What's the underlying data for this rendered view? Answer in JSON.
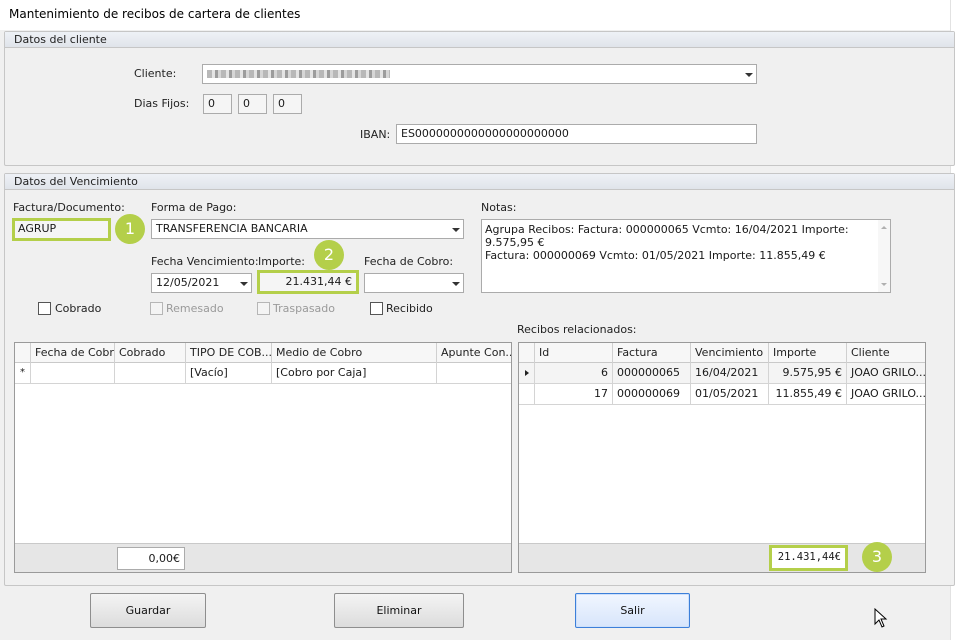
{
  "window": {
    "title": "Mantenimiento de recibos de cartera de clientes"
  },
  "cliente_section": {
    "title": "Datos del cliente",
    "cliente_label": "Cliente:",
    "dias_fijos_label": "Dias Fijos:",
    "dias_fijos": [
      "0",
      "0",
      "0"
    ],
    "iban_label": "IBAN:",
    "iban": "ES0000000000000000000000"
  },
  "vencimiento_section": {
    "title": "Datos del Vencimiento",
    "factura_label": "Factura/Documento:",
    "factura_value": "AGRUP",
    "forma_pago_label": "Forma de Pago:",
    "forma_pago_value": "TRANSFERENCIA BANCARIA",
    "fecha_venc_label": "Fecha Vencimiento:",
    "fecha_venc_value": "12/05/2021",
    "importe_label": "Importe:",
    "importe_value": "21.431,44 €",
    "fecha_cobro_label": "Fecha de Cobro:",
    "fecha_cobro_value": "",
    "notas_label": "Notas:",
    "notas_lines": [
      "Agrupa Recibos: Factura: 000000065 Vcmto: 16/04/2021 Importe: 9.575,95 €",
      "Factura: 000000069 Vcmto: 01/05/2021 Importe: 11.855,49 €"
    ],
    "checkboxes": {
      "cobrado": "Cobrado",
      "remesado": "Remesado",
      "traspasado": "Traspasado",
      "recibido": "Recibido"
    },
    "badges": [
      "1",
      "2",
      "3"
    ]
  },
  "cobros_grid": {
    "columns": [
      "Fecha de Cobro",
      "Cobrado",
      "TIPO DE COB...",
      "Medio de  Cobro",
      "Apunte Con..."
    ],
    "new_row_marker": "*",
    "new_row": [
      "",
      "",
      "[Vacío]",
      "[Cobro por Caja]",
      ""
    ],
    "footer_total": "0,00€"
  },
  "recibos_grid": {
    "title": "Recibos relacionados:",
    "columns": [
      "Id",
      "Factura",
      "Vencimiento",
      "Importe",
      "Cliente"
    ],
    "rows": [
      {
        "id": "6",
        "factura": "000000065",
        "vencimiento": "16/04/2021",
        "importe": "9.575,95 €",
        "cliente": "JOAO GRILO..."
      },
      {
        "id": "17",
        "factura": "000000069",
        "vencimiento": "01/05/2021",
        "importe": "11.855,49 €",
        "cliente": "JOAO GRILO..."
      }
    ],
    "footer_total": "21.431,44€"
  },
  "buttons": {
    "guardar": "Guardar",
    "eliminar": "Eliminar",
    "salir": "Salir"
  },
  "colors": {
    "highlight": "#b4cf4a",
    "primary_button_border": "#3c7fd9"
  }
}
